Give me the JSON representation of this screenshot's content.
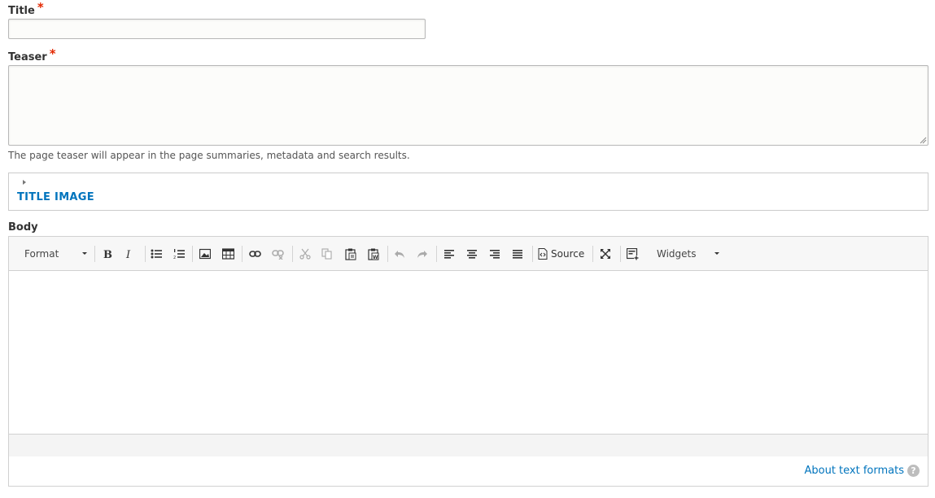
{
  "title_field": {
    "label": "Title",
    "required_mark": "*",
    "value": ""
  },
  "teaser_field": {
    "label": "Teaser",
    "required_mark": "*",
    "value": "",
    "description": "The page teaser will appear in the page summaries, metadata and search results."
  },
  "title_image_section": {
    "title": "TITLE IMAGE",
    "expanded": false
  },
  "body_field": {
    "label": "Body",
    "toolbar": {
      "format_label": "Format",
      "source_label": "Source",
      "widgets_label": "Widgets"
    },
    "content": ""
  },
  "text_formats": {
    "about_link": "About text formats",
    "help_icon": "?"
  },
  "colors": {
    "link": "#0074bd",
    "required": "#e32700"
  }
}
